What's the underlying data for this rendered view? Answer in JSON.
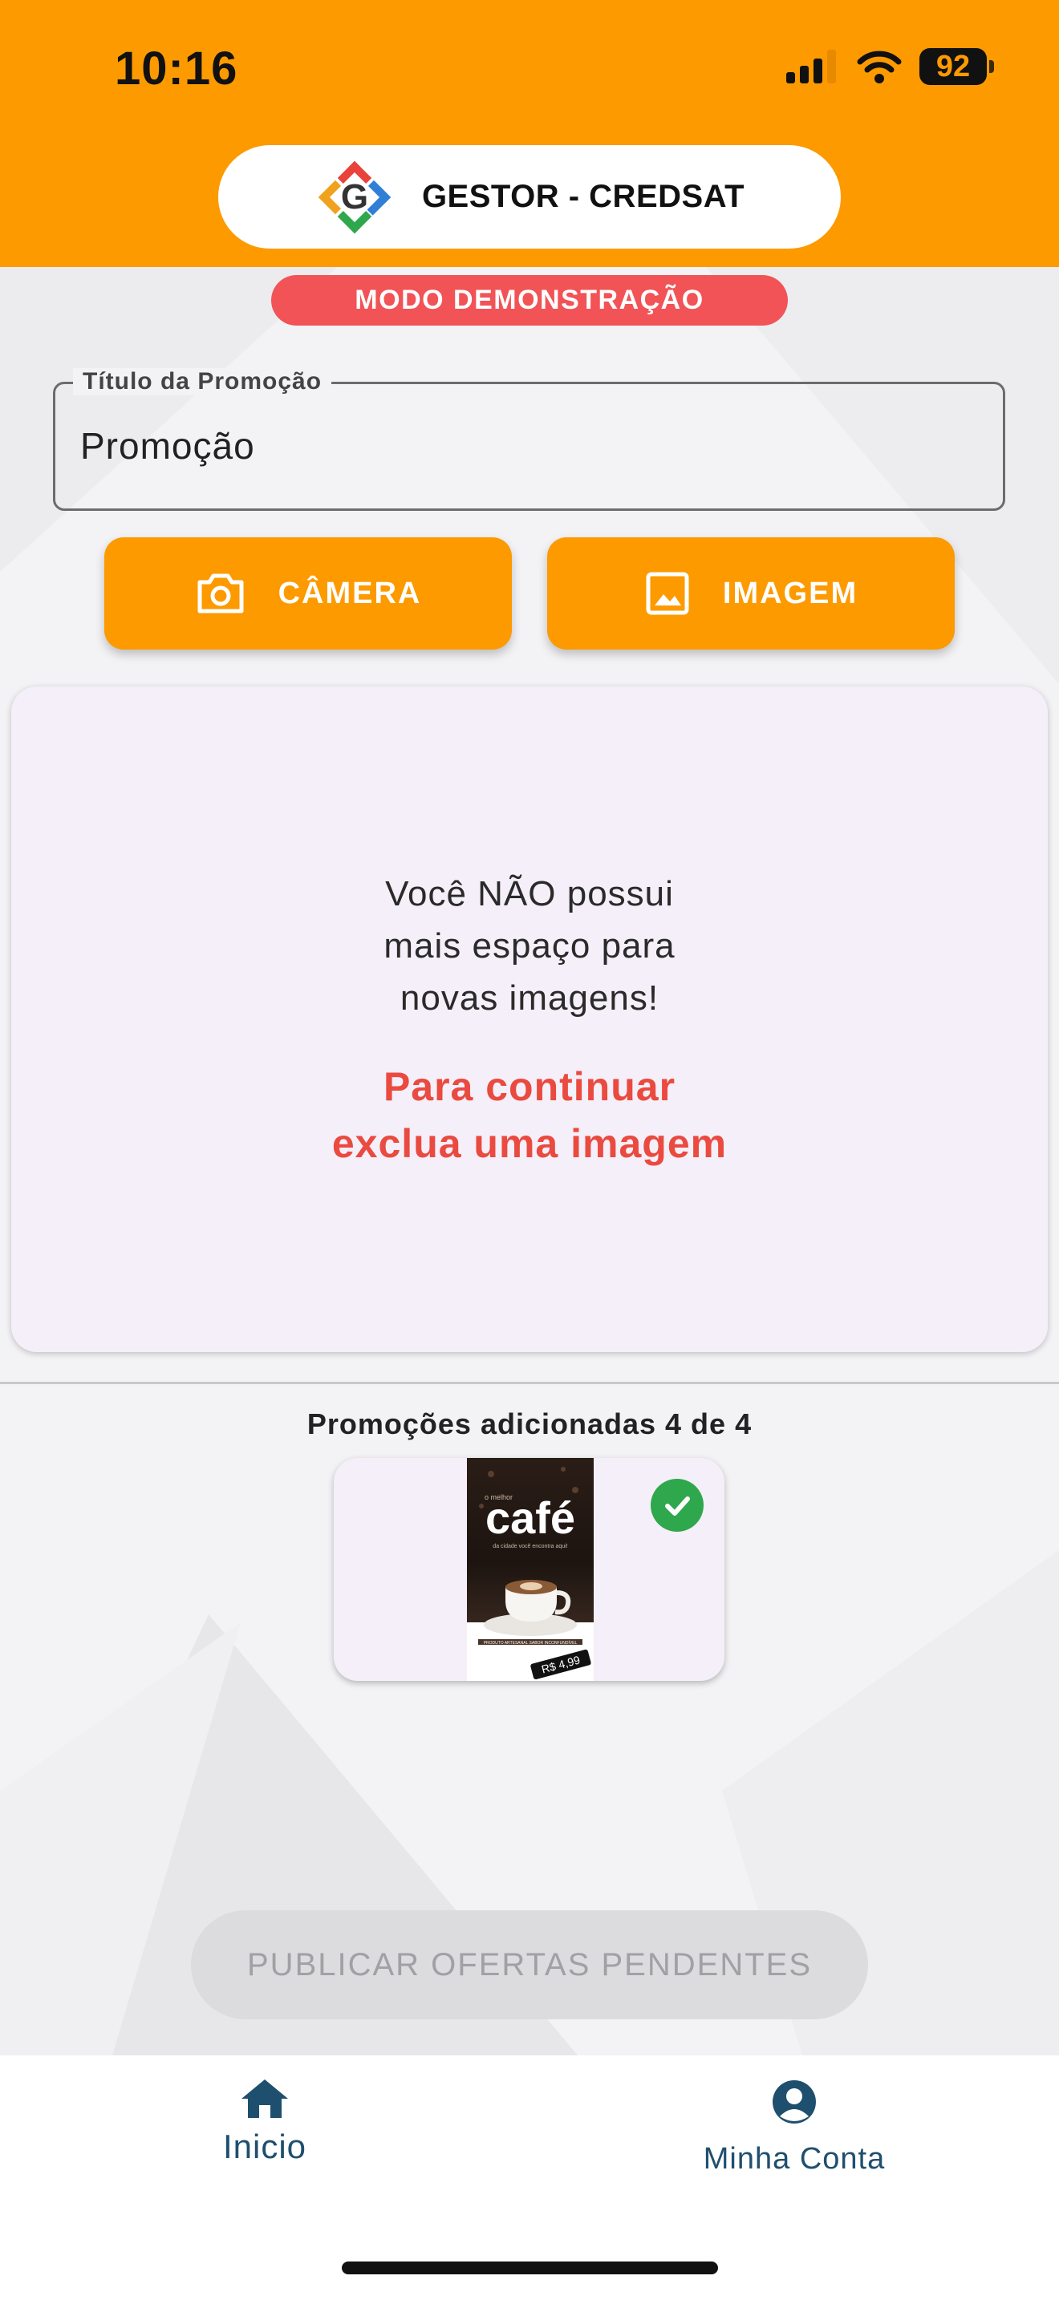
{
  "status_bar": {
    "time": "10:16",
    "battery": "92"
  },
  "header": {
    "brand_letter": "G",
    "brand_title": "GESTOR - CREDSAT"
  },
  "demo_badge": "MODO DEMONSTRAÇÃO",
  "title_field": {
    "label": "Título da Promoção",
    "value": "Promoção"
  },
  "buttons": {
    "camera": "CÂMERA",
    "image": "IMAGEM"
  },
  "warning_card": {
    "message_lines": [
      "Você NÃO possui",
      "mais espaço para",
      "novas imagens!"
    ],
    "warning_lines": [
      "Para continuar",
      "exclua uma imagem"
    ]
  },
  "promotions": {
    "count_label": "Promoções adicionadas 4 de 4",
    "items": [
      {
        "poster_kicker": "o melhor",
        "poster_title": "café",
        "poster_tagline": "da cidade você encontra aqui!",
        "poster_band": "PRODUTO ARTESANAL SABOR INCONFUNDÍVEL",
        "price": "R$ 4,99",
        "selected": true
      }
    ]
  },
  "publish_button": "PUBLICAR OFERTAS PENDENTES",
  "bottom_nav": {
    "items": [
      {
        "label": "Inicio",
        "icon": "home-icon"
      },
      {
        "label": "Minha Conta",
        "icon": "account-circle-icon"
      }
    ]
  },
  "colors": {
    "primary_orange": "#fd9a00",
    "demo_red": "#f25356",
    "warning_red": "#ea4a3f",
    "check_green": "#2fa74c",
    "nav_blue": "#1f4f6e"
  }
}
